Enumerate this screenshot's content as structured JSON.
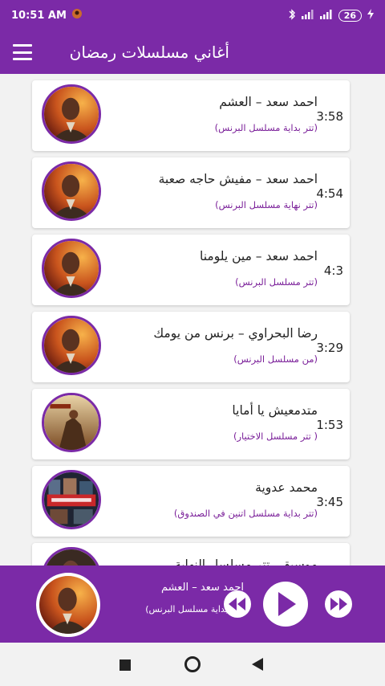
{
  "status_bar": {
    "time": "10:51 AM",
    "battery": "26"
  },
  "app_bar": {
    "title": "أغاني مسلسلات رمضان"
  },
  "songs": [
    {
      "title": "احمد سعد – العشم",
      "subtitle": "(تتر بداية مسلسل البرنس)",
      "duration": "3:58",
      "cover": "portrait"
    },
    {
      "title": "احمد سعد – مفيش حاجه صعبة",
      "subtitle": "(تتر نهاية مسلسل البرنس)",
      "duration": "4:54",
      "cover": "portrait"
    },
    {
      "title": "احمد سعد – مين يلومنا",
      "subtitle": "(تتر مسلسل البرنس)",
      "duration": "4:3",
      "cover": "portrait"
    },
    {
      "title": "رضا البحراوي – برنس من يومك",
      "subtitle": "(من مسلسل البرنس)",
      "duration": "3:29",
      "cover": "portrait"
    },
    {
      "title": "متدمعيش يا أمايا",
      "subtitle": "( تتر مسلسل الاختيار)",
      "duration": "1:53",
      "cover": "poster"
    },
    {
      "title": "محمد عدوية",
      "subtitle": "(تتر بداية مسلسل اتنين في الصندوق)",
      "duration": "3:45",
      "cover": "collage"
    },
    {
      "title": "موسيقى تتر مسلسل النهاية",
      "subtitle": "",
      "duration": "",
      "cover": "portrait"
    }
  ],
  "player": {
    "title": "احمد سعد – العشم",
    "subtitle": "(تتر بداية مسلسل البرنس)"
  },
  "colors": {
    "primary": "#7b2aa7",
    "subtitle": "#7a1f99"
  }
}
